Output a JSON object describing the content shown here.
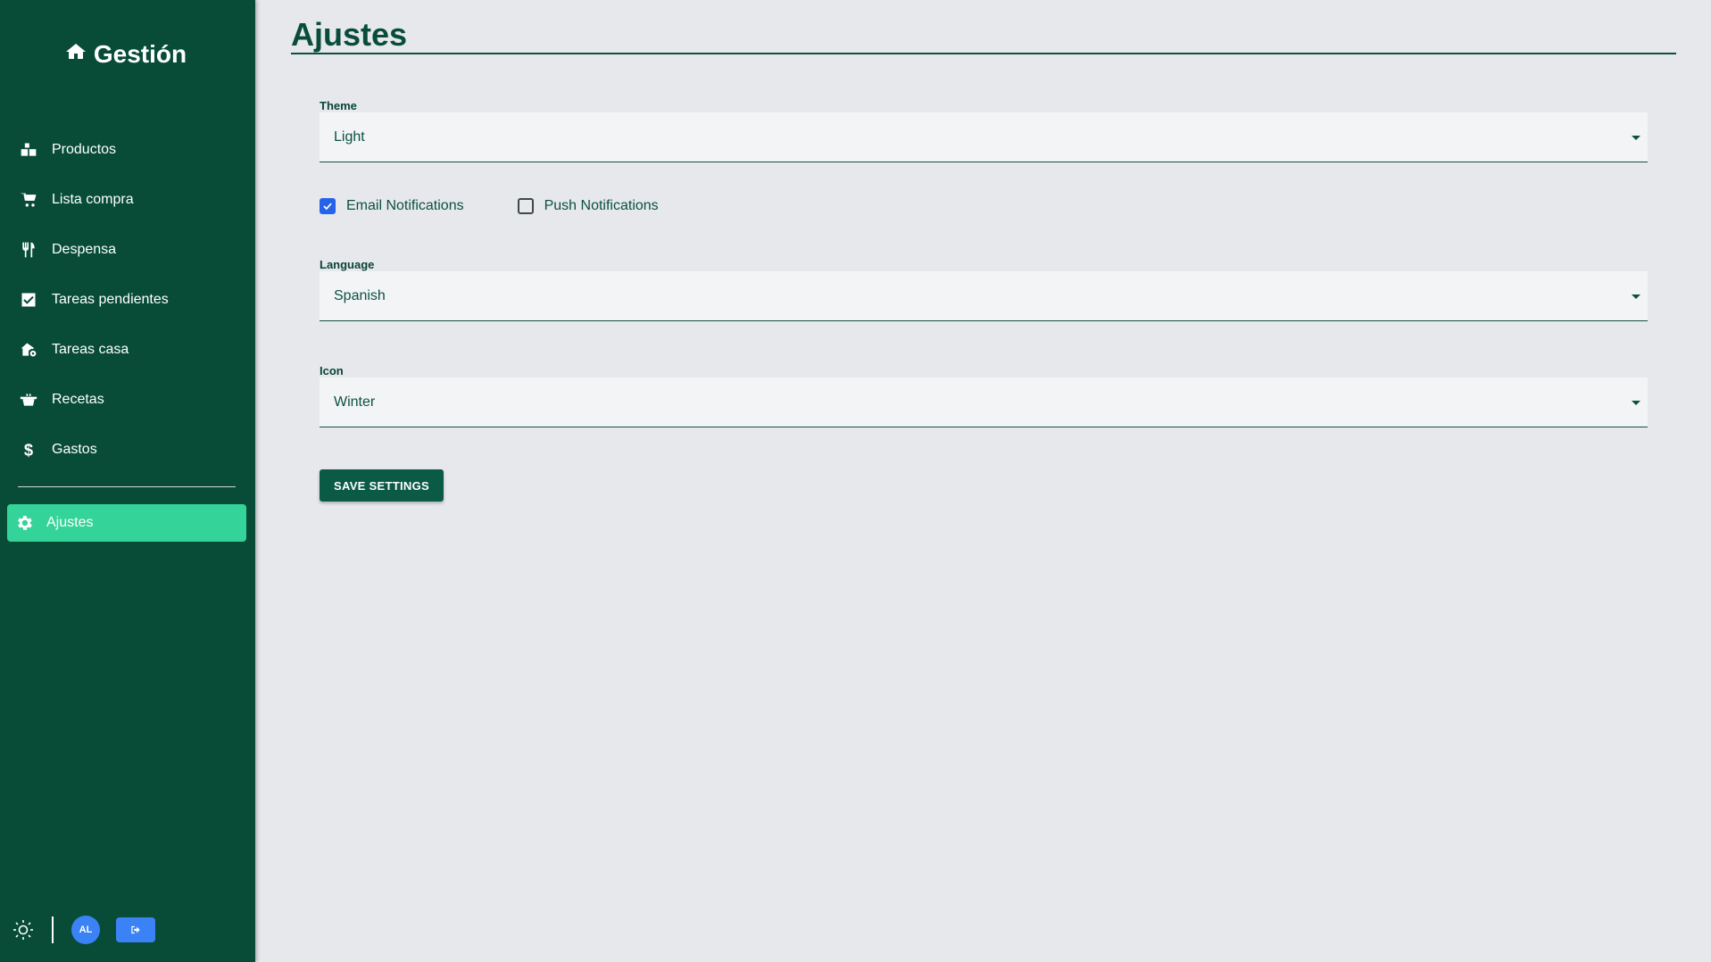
{
  "brand": {
    "name": "Gestión",
    "icon": "home-icon"
  },
  "sidebar": {
    "items": [
      {
        "label": "Productos",
        "icon": "boxes-icon"
      },
      {
        "label": "Lista compra",
        "icon": "cart-icon"
      },
      {
        "label": "Despensa",
        "icon": "utensils-icon"
      },
      {
        "label": "Tareas pendientes",
        "icon": "checkbox-icon"
      },
      {
        "label": "Tareas casa",
        "icon": "house-gear-icon"
      },
      {
        "label": "Recetas",
        "icon": "pot-icon"
      },
      {
        "label": "Gastos",
        "icon": "dollar-icon"
      }
    ],
    "active": {
      "label": "Ajustes",
      "icon": "gear-icon"
    },
    "footer": {
      "avatar_initials": "AL",
      "theme_icon": "sun-icon",
      "logout_icon": "logout-icon"
    }
  },
  "page": {
    "title": "Ajustes"
  },
  "settings": {
    "theme": {
      "label": "Theme",
      "value": "Light"
    },
    "email_notifications": {
      "label": "Email Notifications",
      "checked": true
    },
    "push_notifications": {
      "label": "Push Notifications",
      "checked": false
    },
    "language": {
      "label": "Language",
      "value": "Spanish"
    },
    "icon": {
      "label": "Icon",
      "value": "Winter"
    },
    "save_label": "SAVE SETTINGS"
  },
  "colors": {
    "sidebar_bg": "#084c38",
    "active_item_bg": "#34d399",
    "accent_blue": "#3b82f6",
    "primary_text": "#0b5140",
    "page_bg": "#e6e8ec"
  }
}
